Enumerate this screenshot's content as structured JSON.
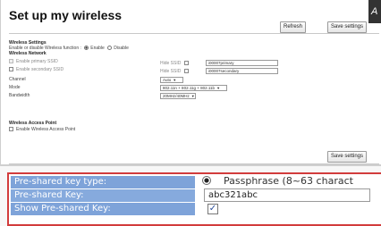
{
  "page": {
    "title": "Set up my wireless",
    "corner_char": "A",
    "refresh_label": "Refresh",
    "save_label": "Save settings",
    "save_label_bottom": "Save settings"
  },
  "wireless_settings": {
    "heading": "Wireless Settings",
    "enable_prompt": "Enable or disable Wireless function :",
    "enable_label": "Enable",
    "disable_label": "Disable",
    "enabled": true
  },
  "wireless_network": {
    "heading": "Wireless Network",
    "primary_label": "Enable primary SSID",
    "secondary_label": "Enable secondary SSID",
    "hide_ssid_label": "Hide SSID",
    "primary_ssid": "i00007primary",
    "secondary_ssid": "i00007secondary",
    "channel_label": "Channel",
    "channel_value": "Auto",
    "mode_label": "Mode",
    "mode_value": "802.11n + 802.11g + 802.11b",
    "bandwidth_label": "Bandwidth",
    "bandwidth_value": "20MHz/40MHz"
  },
  "access_point": {
    "heading": "Wireless Access Point",
    "enable_label": "Enable Wireless Access Point"
  },
  "zoom": {
    "psk_type_label": "Pre-shared key type:",
    "psk_type_value": "Passphrase (8~63 charact",
    "psk_label": "Pre-shared Key:",
    "psk_value": "abc321abc",
    "show_psk_label": "Show Pre-shared Key:",
    "show_psk_checked": "✓"
  },
  "colors": {
    "zoom_label_bg": "#7ea3d9",
    "highlight_border": "#d23c3c"
  }
}
